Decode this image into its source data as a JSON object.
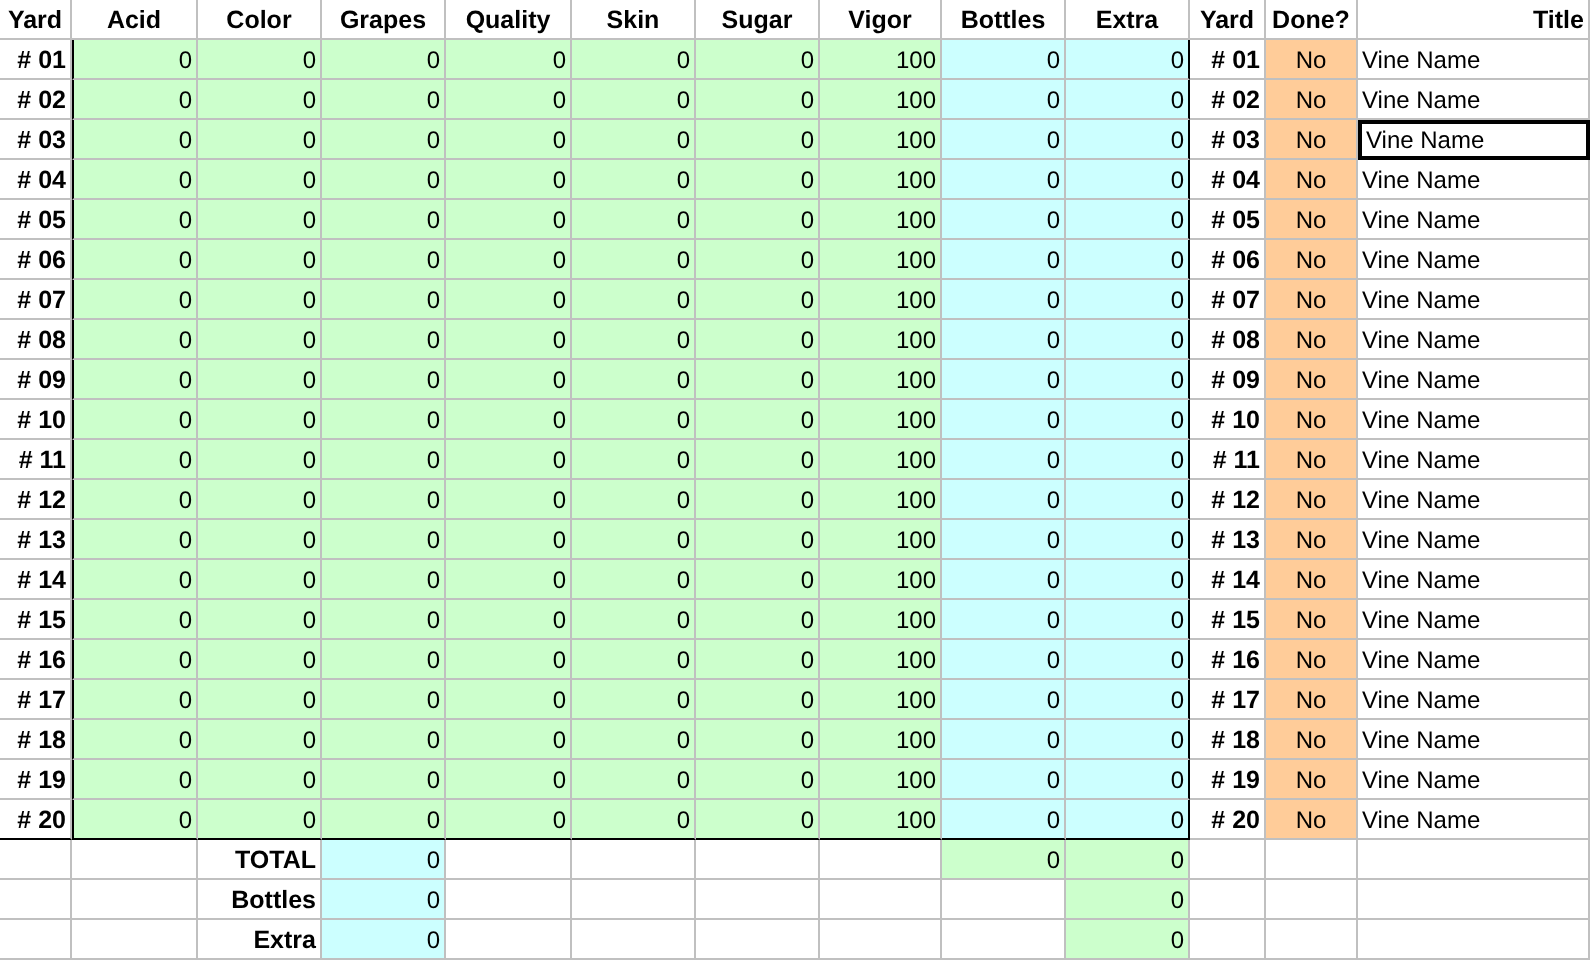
{
  "columns": [
    "Yard",
    "Acid",
    "Color",
    "Grapes",
    "Quality",
    "Skin",
    "Sugar",
    "Vigor",
    "Bottles",
    "Extra",
    "Yard",
    "Done?",
    "Title"
  ],
  "rows": [
    {
      "yard": "# 01",
      "values": [
        "0",
        "0",
        "0",
        "0",
        "0",
        "0",
        "100",
        "0",
        "0"
      ],
      "yard_2": "# 01",
      "done": "No",
      "title": "Vine Name",
      "selected": false
    },
    {
      "yard": "# 02",
      "values": [
        "0",
        "0",
        "0",
        "0",
        "0",
        "0",
        "100",
        "0",
        "0"
      ],
      "yard_2": "# 02",
      "done": "No",
      "title": "Vine Name",
      "selected": false
    },
    {
      "yard": "# 03",
      "values": [
        "0",
        "0",
        "0",
        "0",
        "0",
        "0",
        "100",
        "0",
        "0"
      ],
      "yard_2": "# 03",
      "done": "No",
      "title": "Vine Name",
      "selected": true
    },
    {
      "yard": "# 04",
      "values": [
        "0",
        "0",
        "0",
        "0",
        "0",
        "0",
        "100",
        "0",
        "0"
      ],
      "yard_2": "# 04",
      "done": "No",
      "title": "Vine Name",
      "selected": false
    },
    {
      "yard": "# 05",
      "values": [
        "0",
        "0",
        "0",
        "0",
        "0",
        "0",
        "100",
        "0",
        "0"
      ],
      "yard_2": "# 05",
      "done": "No",
      "title": "Vine Name",
      "selected": false
    },
    {
      "yard": "# 06",
      "values": [
        "0",
        "0",
        "0",
        "0",
        "0",
        "0",
        "100",
        "0",
        "0"
      ],
      "yard_2": "# 06",
      "done": "No",
      "title": "Vine Name",
      "selected": false
    },
    {
      "yard": "# 07",
      "values": [
        "0",
        "0",
        "0",
        "0",
        "0",
        "0",
        "100",
        "0",
        "0"
      ],
      "yard_2": "# 07",
      "done": "No",
      "title": "Vine Name",
      "selected": false
    },
    {
      "yard": "# 08",
      "values": [
        "0",
        "0",
        "0",
        "0",
        "0",
        "0",
        "100",
        "0",
        "0"
      ],
      "yard_2": "# 08",
      "done": "No",
      "title": "Vine Name",
      "selected": false
    },
    {
      "yard": "# 09",
      "values": [
        "0",
        "0",
        "0",
        "0",
        "0",
        "0",
        "100",
        "0",
        "0"
      ],
      "yard_2": "# 09",
      "done": "No",
      "title": "Vine Name",
      "selected": false
    },
    {
      "yard": "# 10",
      "values": [
        "0",
        "0",
        "0",
        "0",
        "0",
        "0",
        "100",
        "0",
        "0"
      ],
      "yard_2": "# 10",
      "done": "No",
      "title": "Vine Name",
      "selected": false
    },
    {
      "yard": "# 11",
      "values": [
        "0",
        "0",
        "0",
        "0",
        "0",
        "0",
        "100",
        "0",
        "0"
      ],
      "yard_2": "# 11",
      "done": "No",
      "title": "Vine Name",
      "selected": false
    },
    {
      "yard": "# 12",
      "values": [
        "0",
        "0",
        "0",
        "0",
        "0",
        "0",
        "100",
        "0",
        "0"
      ],
      "yard_2": "# 12",
      "done": "No",
      "title": "Vine Name",
      "selected": false
    },
    {
      "yard": "# 13",
      "values": [
        "0",
        "0",
        "0",
        "0",
        "0",
        "0",
        "100",
        "0",
        "0"
      ],
      "yard_2": "# 13",
      "done": "No",
      "title": "Vine Name",
      "selected": false
    },
    {
      "yard": "# 14",
      "values": [
        "0",
        "0",
        "0",
        "0",
        "0",
        "0",
        "100",
        "0",
        "0"
      ],
      "yard_2": "# 14",
      "done": "No",
      "title": "Vine Name",
      "selected": false
    },
    {
      "yard": "# 15",
      "values": [
        "0",
        "0",
        "0",
        "0",
        "0",
        "0",
        "100",
        "0",
        "0"
      ],
      "yard_2": "# 15",
      "done": "No",
      "title": "Vine Name",
      "selected": false
    },
    {
      "yard": "# 16",
      "values": [
        "0",
        "0",
        "0",
        "0",
        "0",
        "0",
        "100",
        "0",
        "0"
      ],
      "yard_2": "# 16",
      "done": "No",
      "title": "Vine Name",
      "selected": false
    },
    {
      "yard": "# 17",
      "values": [
        "0",
        "0",
        "0",
        "0",
        "0",
        "0",
        "100",
        "0",
        "0"
      ],
      "yard_2": "# 17",
      "done": "No",
      "title": "Vine Name",
      "selected": false
    },
    {
      "yard": "# 18",
      "values": [
        "0",
        "0",
        "0",
        "0",
        "0",
        "0",
        "100",
        "0",
        "0"
      ],
      "yard_2": "# 18",
      "done": "No",
      "title": "Vine Name",
      "selected": false
    },
    {
      "yard": "# 19",
      "values": [
        "0",
        "0",
        "0",
        "0",
        "0",
        "0",
        "100",
        "0",
        "0"
      ],
      "yard_2": "# 19",
      "done": "No",
      "title": "Vine Name",
      "selected": false
    },
    {
      "yard": "# 20",
      "values": [
        "0",
        "0",
        "0",
        "0",
        "0",
        "0",
        "100",
        "0",
        "0"
      ],
      "yard_2": "# 20",
      "done": "No",
      "title": "Vine Name",
      "selected": false
    }
  ],
  "summary": [
    {
      "label": "TOTAL",
      "value": "0",
      "bottles": "0",
      "extra": "0"
    },
    {
      "label": "Bottles",
      "value": "0",
      "extra": "0"
    },
    {
      "label": "Extra",
      "value": "0",
      "extra": "0"
    }
  ]
}
